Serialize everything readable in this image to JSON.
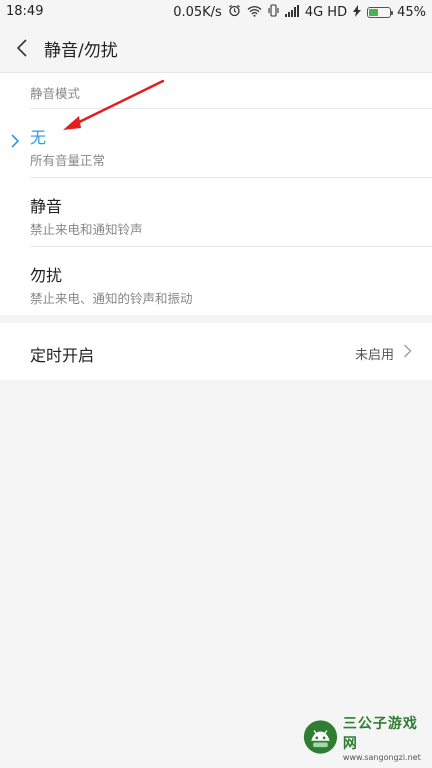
{
  "status_bar": {
    "time": "18:49",
    "speed": "0.05K/s",
    "network": "4G HD",
    "battery": "45%",
    "battery_level": 0.45,
    "icons": [
      "alarm-icon",
      "wifi-icon",
      "vibrate-icon",
      "signal-icon",
      "charging-icon",
      "battery-icon"
    ]
  },
  "header": {
    "title": "静音/勿扰",
    "back_icon": "chevron-left-icon"
  },
  "modes": {
    "section_label": "静音模式",
    "items": [
      {
        "title": "无",
        "subtitle": "所有音量正常",
        "selected": true
      },
      {
        "title": "静音",
        "subtitle": "禁止来电和通知铃声",
        "selected": false
      },
      {
        "title": "勿扰",
        "subtitle": "禁止来电、通知的铃声和振动",
        "selected": false
      }
    ]
  },
  "timer": {
    "label": "定时开启",
    "status": "未启用"
  },
  "annotation": {
    "color": "#e02020"
  },
  "watermark": {
    "name": "三公子游戏网",
    "url": "www.sangongzi.net"
  },
  "colors": {
    "accent": "#2a9bf0",
    "background": "#f5f5f5",
    "card": "#ffffff",
    "battery_fill": "#4caf50"
  }
}
